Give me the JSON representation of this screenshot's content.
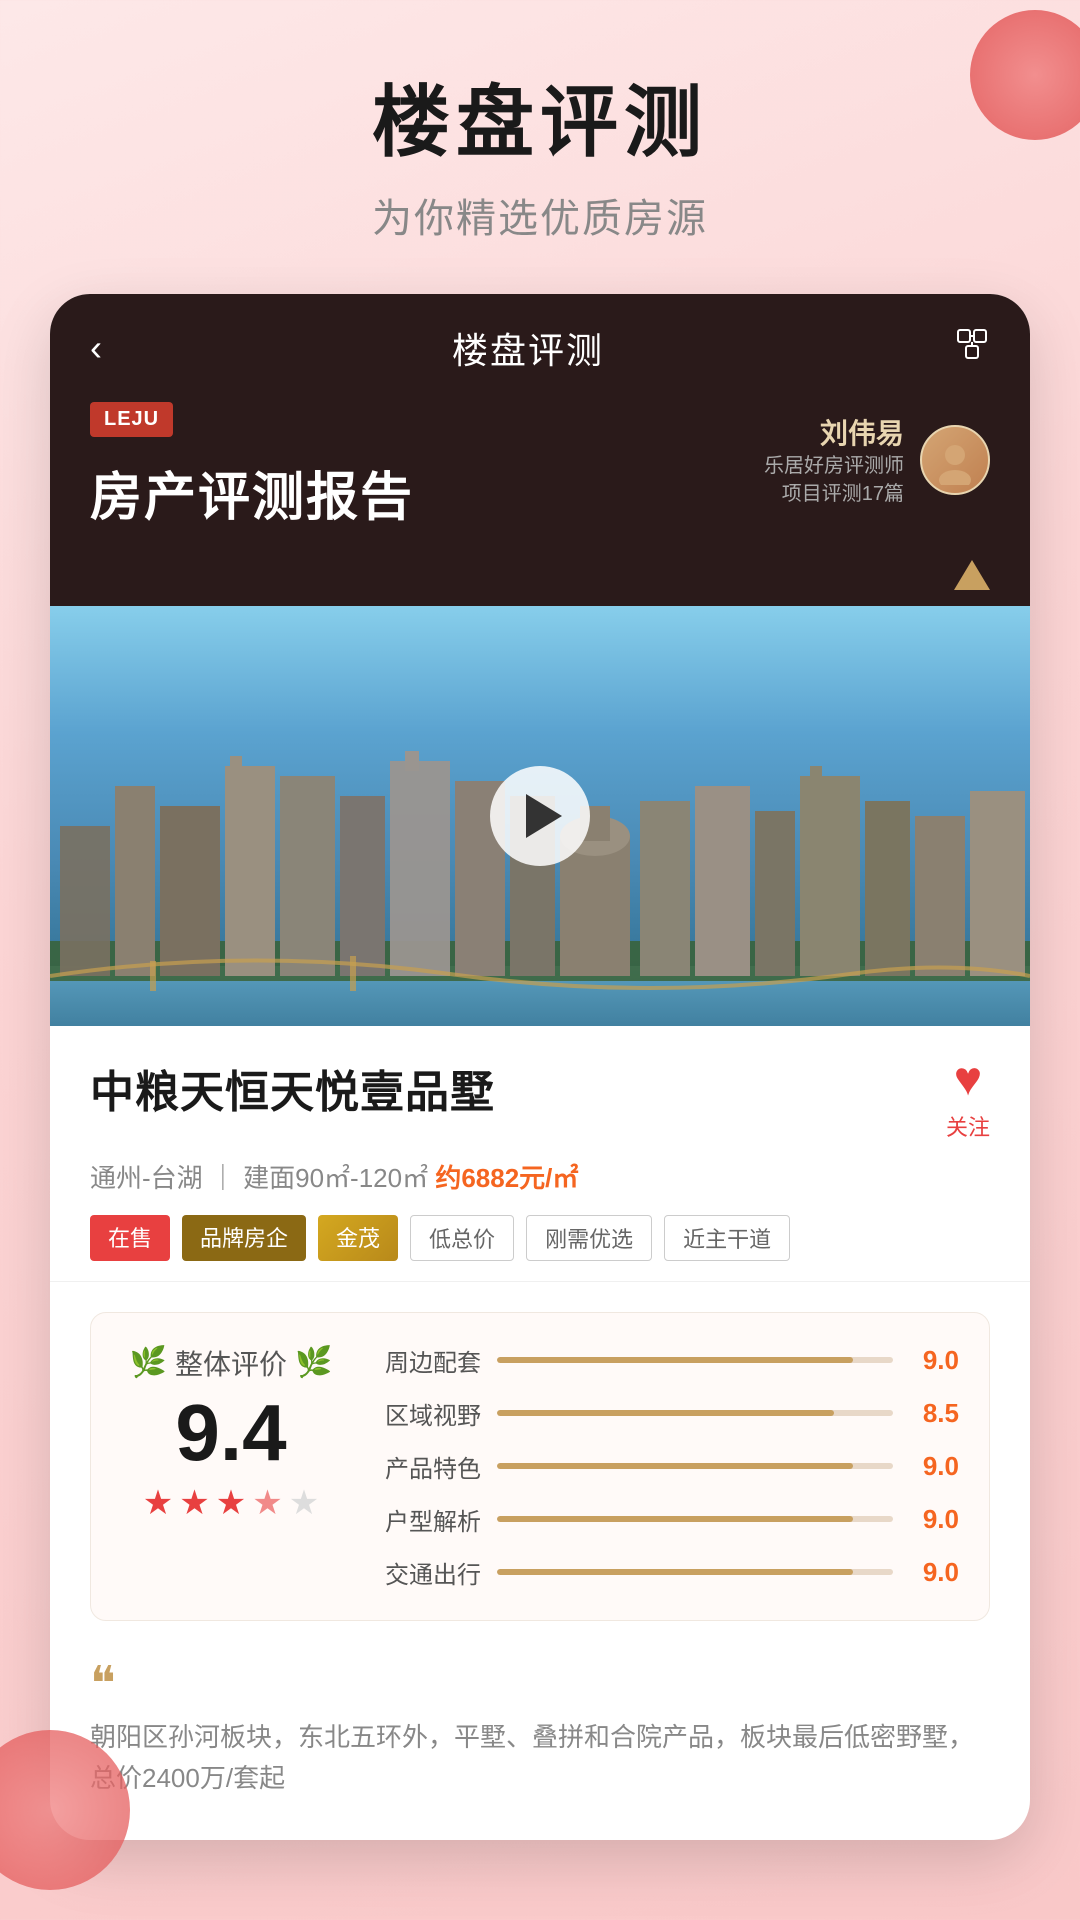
{
  "header": {
    "title": "楼盘评测",
    "subtitle": "为你精选优质房源"
  },
  "appBar": {
    "back": "‹",
    "title": "楼盘评测",
    "share": "⎋"
  },
  "report": {
    "badge": "LEJU",
    "mainTitle": "房产评测报告",
    "reviewer": {
      "name": "刘伟易",
      "desc1": "乐居好房评测师",
      "desc2": "项目评测17篇"
    }
  },
  "property": {
    "name": "中粮天恒天悦壹品墅",
    "location": "通州-台湖",
    "area": "建面90㎡-120㎡",
    "price": "约6882元/㎡",
    "followLabel": "关注",
    "tags": [
      {
        "label": "在售",
        "type": "sale"
      },
      {
        "label": "品牌房企",
        "type": "brand"
      },
      {
        "label": "金茂",
        "type": "jinmao"
      },
      {
        "label": "低总价",
        "type": "outline"
      },
      {
        "label": "刚需优选",
        "type": "outline"
      },
      {
        "label": "近主干道",
        "type": "outline"
      }
    ]
  },
  "rating": {
    "overallLabel": "整体评价",
    "overallScore": "9.4",
    "stars": [
      {
        "type": "full"
      },
      {
        "type": "full"
      },
      {
        "type": "full"
      },
      {
        "type": "half"
      },
      {
        "type": "empty"
      }
    ],
    "details": [
      {
        "label": "周边配套",
        "value": "9.0",
        "percent": 90
      },
      {
        "label": "区域视野",
        "value": "8.5",
        "percent": 85
      },
      {
        "label": "产品特色",
        "value": "9.0",
        "percent": 90
      },
      {
        "label": "户型解析",
        "value": "9.0",
        "percent": 90
      },
      {
        "label": "交通出行",
        "value": "9.0",
        "percent": 90
      }
    ]
  },
  "quote": {
    "mark": "❝",
    "text": "朝阳区孙河板块，东北五环外，平墅、叠拼和合院产品，板块最后低密野墅，总价2400万/套起"
  }
}
